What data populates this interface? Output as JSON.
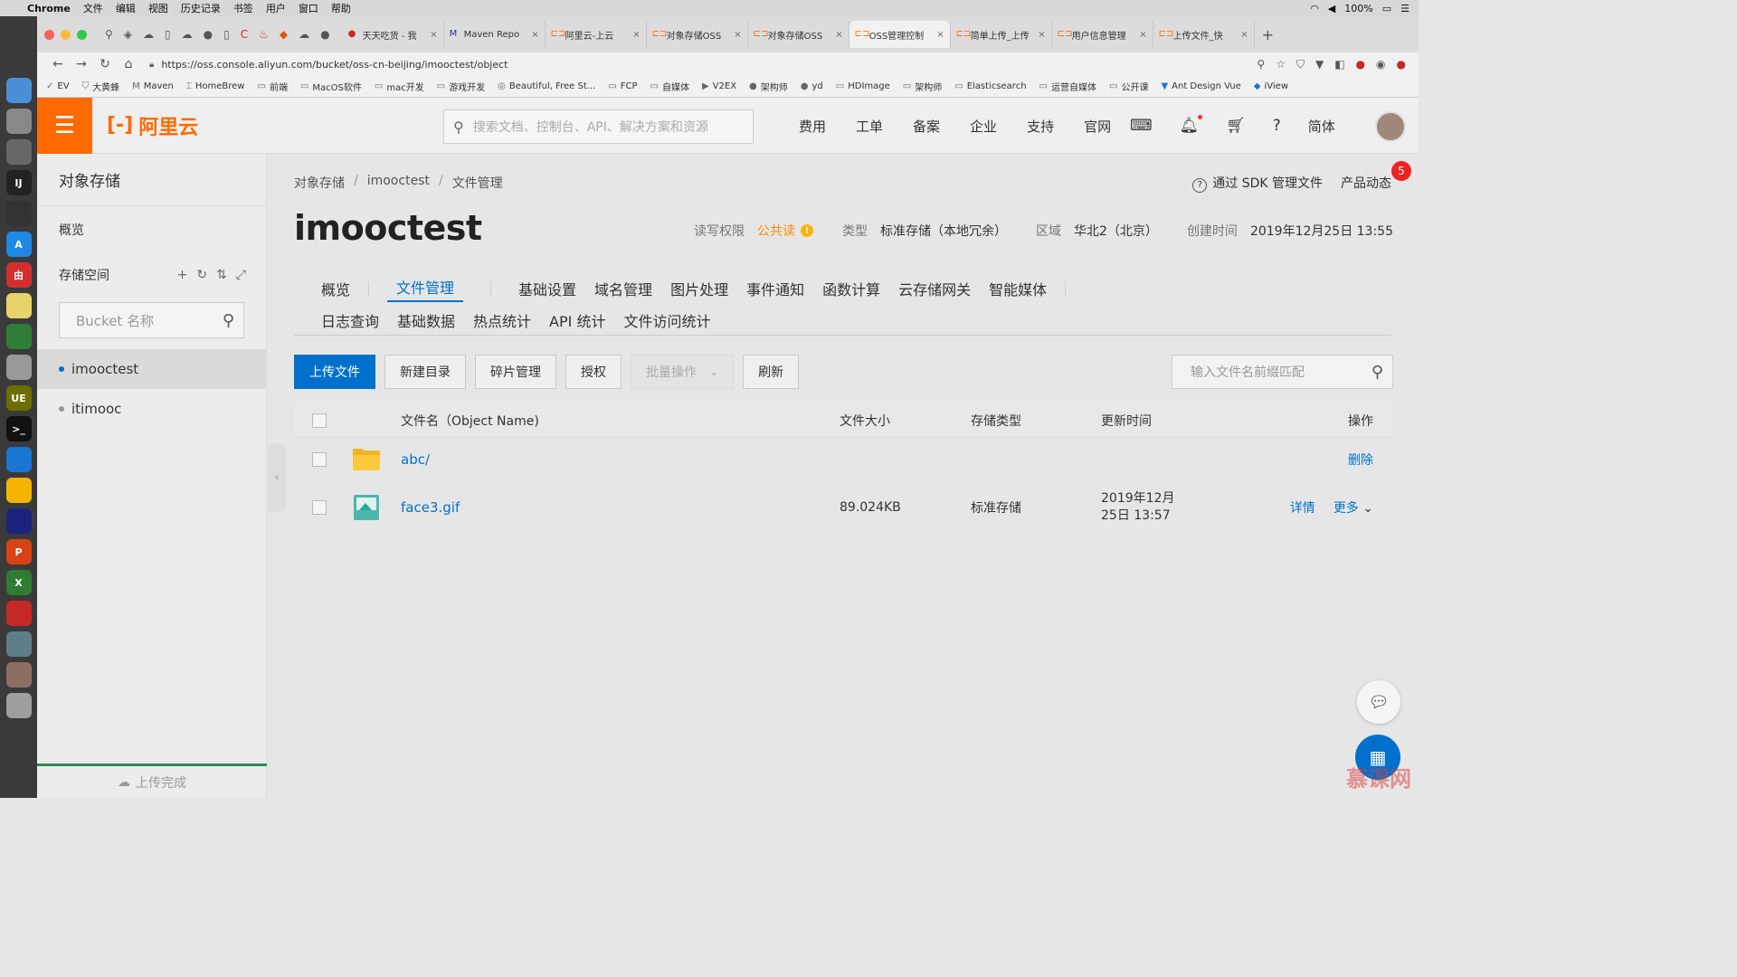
{
  "menubar": {
    "app": "Chrome",
    "items": [
      "文件",
      "编辑",
      "视图",
      "历史记录",
      "书签",
      "用户",
      "窗口",
      "帮助"
    ],
    "battery": "100%"
  },
  "browser": {
    "tabs": [
      {
        "label": "天天吃货 - 我",
        "icon": "red-circle-icon"
      },
      {
        "label": "Maven Repo",
        "icon": "maven-icon"
      },
      {
        "label": "阿里云-上云",
        "icon": "aliyun-icon"
      },
      {
        "label": "对象存储OSS",
        "icon": "aliyun-icon"
      },
      {
        "label": "对象存储OSS",
        "icon": "aliyun-icon"
      },
      {
        "label": "OSS管理控制",
        "icon": "aliyun-icon"
      },
      {
        "label": "简单上传_上传",
        "icon": "aliyun-icon"
      },
      {
        "label": "用户信息管理",
        "icon": "aliyun-icon"
      },
      {
        "label": "上传文件_快",
        "icon": "aliyun-icon"
      }
    ],
    "url": "https://oss.console.aliyun.com/bucket/oss-cn-beijing/imooctest/object",
    "bookmarks": [
      "EV",
      "大黄蜂",
      "Maven",
      "HomeBrew",
      "前端",
      "MacOS软件",
      "mac开发",
      "游戏开发",
      "Beautiful, Free St...",
      "FCP",
      "自媒体",
      "V2EX",
      "架构师",
      "yd",
      "HDImage",
      "架构师",
      "Elasticsearch",
      "运营自媒体",
      "公开课",
      "Ant Design Vue",
      "iView"
    ]
  },
  "header": {
    "logo_text": "阿里云",
    "search_placeholder": "搜索文档、控制台、API、解决方案和资源",
    "nav": [
      "费用",
      "工单",
      "备案",
      "企业",
      "支持",
      "官网"
    ],
    "lang": "简体"
  },
  "sidebar": {
    "title": "对象存储",
    "overview": "概览",
    "buckets_label": "存储空间",
    "bucket_search_placeholder": "Bucket 名称",
    "buckets": [
      "imooctest",
      "itimooc"
    ],
    "footer": "上传完成"
  },
  "main": {
    "breadcrumb": [
      "对象存储",
      "imooctest",
      "文件管理"
    ],
    "sdk_link": "通过 SDK 管理文件",
    "product_news": "产品动态",
    "news_badge": "5",
    "bucket_name": "imooctest",
    "meta": {
      "acl_label": "读写权限",
      "acl_value": "公共读",
      "type_label": "类型",
      "type_value": "标准存储（本地冗余）",
      "region_label": "区域",
      "region_value": "华北2（北京）",
      "created_label": "创建时间",
      "created_value": "2019年12月25日 13:55"
    },
    "tabs_row1": [
      "概览",
      "文件管理",
      "基础设置",
      "域名管理",
      "图片处理",
      "事件通知",
      "函数计算",
      "云存储网关",
      "智能媒体"
    ],
    "tabs_row2": [
      "日志查询",
      "基础数据",
      "热点统计",
      "API 统计",
      "文件访问统计"
    ],
    "toolbar": {
      "upload": "上传文件",
      "new_dir": "新建目录",
      "fragments": "碎片管理",
      "authorize": "授权",
      "batch": "批量操作",
      "refresh": "刷新",
      "prefix_placeholder": "输入文件名前缀匹配"
    },
    "table": {
      "headers": [
        "文件名（Object Name)",
        "文件大小",
        "存储类型",
        "更新时间",
        "操作"
      ],
      "rows": [
        {
          "name": "abc/",
          "size": "",
          "storage": "",
          "time_line1": "",
          "time_line2": "",
          "actions": [
            "删除"
          ]
        },
        {
          "name": "face3.gif",
          "size": "89.024KB",
          "storage": "标准存储",
          "time_line1": "2019年12月",
          "time_line2": "25日 13:57",
          "actions": [
            "详情",
            "更多"
          ]
        }
      ]
    }
  },
  "watermark": "慕课网"
}
